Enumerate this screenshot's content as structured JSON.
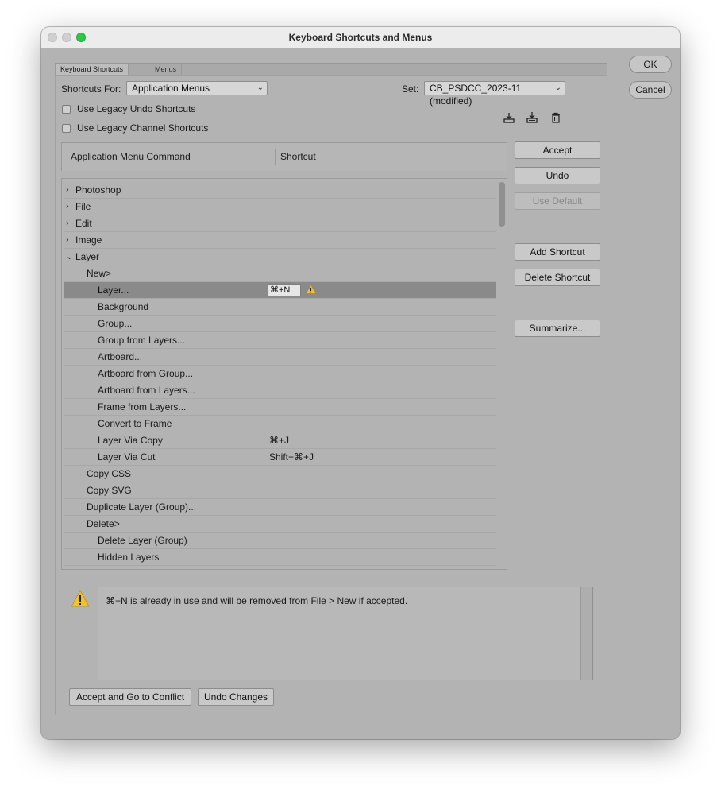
{
  "window": {
    "title": "Keyboard Shortcuts and Menus"
  },
  "tabs": [
    {
      "label": "Keyboard Shortcuts"
    },
    {
      "label": "Menus"
    }
  ],
  "shortcuts_for": {
    "label": "Shortcuts For:",
    "value": "Application Menus"
  },
  "set": {
    "label": "Set:",
    "value": "CB_PSDCC_2023-11 (modified)"
  },
  "checkboxes": [
    {
      "label": "Use Legacy Undo Shortcuts",
      "checked": false
    },
    {
      "label": "Use Legacy Channel Shortcuts",
      "checked": false
    }
  ],
  "icons": {
    "save_set": "save-set-icon",
    "new_set": "new-set-icon",
    "delete_set": "trash-icon",
    "warning": "warning-icon"
  },
  "table": {
    "headers": {
      "command": "Application Menu Command",
      "shortcut": "Shortcut"
    },
    "rows": [
      {
        "label": "Photoshop",
        "indent": 0,
        "expander": "›",
        "shortcut": ""
      },
      {
        "label": "File",
        "indent": 0,
        "expander": "›",
        "shortcut": ""
      },
      {
        "label": "Edit",
        "indent": 0,
        "expander": "›",
        "shortcut": ""
      },
      {
        "label": "Image",
        "indent": 0,
        "expander": "›",
        "shortcut": ""
      },
      {
        "label": "Layer",
        "indent": 0,
        "expander": "⌄",
        "shortcut": ""
      },
      {
        "label": "New>",
        "indent": 1,
        "expander": "",
        "shortcut": ""
      },
      {
        "label": "Layer...",
        "indent": 2,
        "expander": "",
        "shortcut": "⌘+N",
        "selected": true,
        "conflict": true
      },
      {
        "label": "Background",
        "indent": 2,
        "expander": "",
        "shortcut": ""
      },
      {
        "label": "Group...",
        "indent": 2,
        "expander": "",
        "shortcut": ""
      },
      {
        "label": "Group from Layers...",
        "indent": 2,
        "expander": "",
        "shortcut": ""
      },
      {
        "label": "Artboard...",
        "indent": 2,
        "expander": "",
        "shortcut": ""
      },
      {
        "label": "Artboard from Group...",
        "indent": 2,
        "expander": "",
        "shortcut": ""
      },
      {
        "label": "Artboard from Layers...",
        "indent": 2,
        "expander": "",
        "shortcut": ""
      },
      {
        "label": "Frame from Layers...",
        "indent": 2,
        "expander": "",
        "shortcut": ""
      },
      {
        "label": "Convert to Frame",
        "indent": 2,
        "expander": "",
        "shortcut": ""
      },
      {
        "label": "Layer Via Copy",
        "indent": 2,
        "expander": "",
        "shortcut": "⌘+J"
      },
      {
        "label": "Layer Via Cut",
        "indent": 2,
        "expander": "",
        "shortcut": "Shift+⌘+J"
      },
      {
        "label": "Copy CSS",
        "indent": 1,
        "expander": "",
        "shortcut": ""
      },
      {
        "label": "Copy SVG",
        "indent": 1,
        "expander": "",
        "shortcut": ""
      },
      {
        "label": "Duplicate Layer (Group)...",
        "indent": 1,
        "expander": "",
        "shortcut": ""
      },
      {
        "label": "Delete>",
        "indent": 1,
        "expander": "",
        "shortcut": ""
      },
      {
        "label": "Delete Layer (Group)",
        "indent": 2,
        "expander": "",
        "shortcut": ""
      },
      {
        "label": "Hidden Layers",
        "indent": 2,
        "expander": "",
        "shortcut": ""
      }
    ]
  },
  "side_buttons": {
    "accept": "Accept",
    "undo": "Undo",
    "use_default": "Use Default",
    "add_shortcut": "Add Shortcut",
    "delete_shortcut": "Delete Shortcut",
    "summarize": "Summarize..."
  },
  "dialog_buttons": {
    "ok": "OK",
    "cancel": "Cancel"
  },
  "message": "⌘+N is already in use and will be removed from File > New if accepted.",
  "bottom_buttons": {
    "accept_go": "Accept and Go to Conflict",
    "undo_changes": "Undo Changes"
  },
  "colors": {
    "selected_row": "#8a8a8a",
    "warning": "#f2c12e",
    "window_bg": "#b3b3b3"
  }
}
